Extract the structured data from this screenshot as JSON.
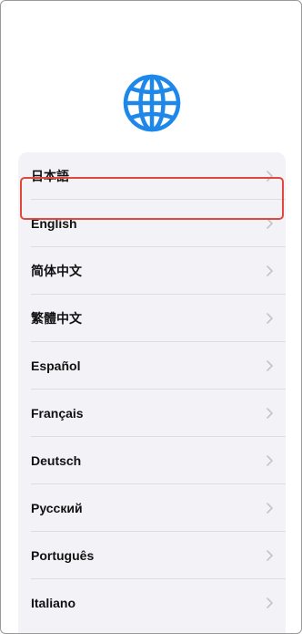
{
  "header": {
    "icon": "globe-icon",
    "accent_color": "#1e88ea"
  },
  "languages": [
    {
      "label": "日本語",
      "selected": true
    },
    {
      "label": "English"
    },
    {
      "label": "简体中文"
    },
    {
      "label": "繁體中文"
    },
    {
      "label": "Español"
    },
    {
      "label": "Français"
    },
    {
      "label": "Deutsch"
    },
    {
      "label": "Русский"
    },
    {
      "label": "Português"
    },
    {
      "label": "Italiano"
    }
  ],
  "row_chevron_icon": "chevron-right-icon",
  "highlight_color": "#e0473d"
}
